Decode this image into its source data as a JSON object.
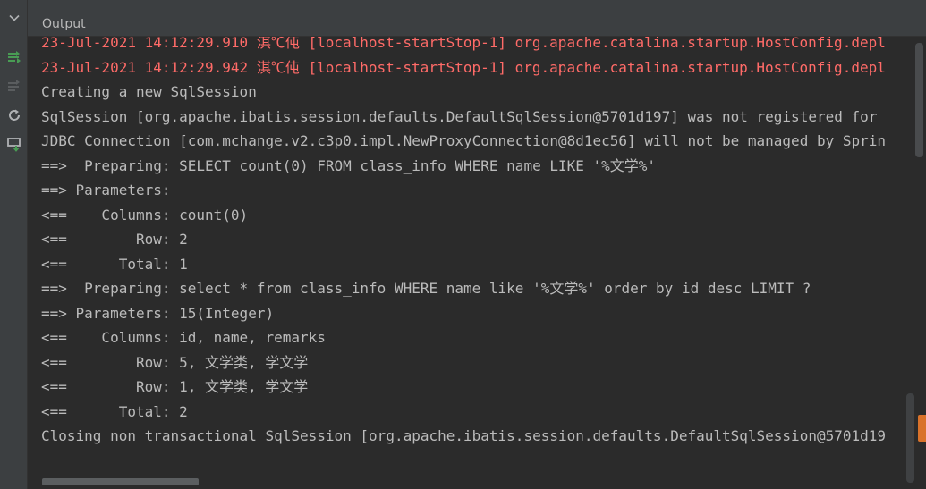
{
  "panel": {
    "title": "Output"
  },
  "toolbar": {
    "icons": [
      "collapse-chevron-icon",
      "scroll-to-end-icon",
      "scroll-disabled-icon",
      "rerun-icon",
      "deploy-icon"
    ]
  },
  "console": {
    "lines": [
      {
        "text": "23-Jul-2021 14:12:29.910 淇℃伅 [localhost-startStop-1] org.apache.catalina.startup.HostConfig.depl",
        "kind": "err"
      },
      {
        "text": "23-Jul-2021 14:12:29.942 淇℃伅 [localhost-startStop-1] org.apache.catalina.startup.HostConfig.depl",
        "kind": "err"
      },
      {
        "text": "Creating a new SqlSession",
        "kind": "out"
      },
      {
        "text": "SqlSession [org.apache.ibatis.session.defaults.DefaultSqlSession@5701d197] was not registered for",
        "kind": "out"
      },
      {
        "text": "JDBC Connection [com.mchange.v2.c3p0.impl.NewProxyConnection@8d1ec56] will not be managed by Sprin",
        "kind": "out"
      },
      {
        "text": "==>  Preparing: SELECT count(0) FROM class_info WHERE name LIKE '%文学%'",
        "kind": "out"
      },
      {
        "text": "==> Parameters: ",
        "kind": "out"
      },
      {
        "text": "<==    Columns: count(0)",
        "kind": "out"
      },
      {
        "text": "<==        Row: 2",
        "kind": "out"
      },
      {
        "text": "<==      Total: 1",
        "kind": "out"
      },
      {
        "text": "==>  Preparing: select * from class_info WHERE name like '%文学%' order by id desc LIMIT ?",
        "kind": "out"
      },
      {
        "text": "==> Parameters: 15(Integer)",
        "kind": "out"
      },
      {
        "text": "<==    Columns: id, name, remarks",
        "kind": "out"
      },
      {
        "text": "<==        Row: 5, 文学类, 学文学",
        "kind": "out"
      },
      {
        "text": "<==        Row: 1, 文学类, 学文学",
        "kind": "out"
      },
      {
        "text": "<==      Total: 2",
        "kind": "out"
      },
      {
        "text": "Closing non transactional SqlSession [org.apache.ibatis.session.defaults.DefaultSqlSession@5701d19",
        "kind": "out"
      }
    ]
  },
  "colors": {
    "background": "#2b2b2b",
    "panel": "#3c3f41",
    "text": "#bbbbbb",
    "error": "#ff6b68",
    "accent_green": "#499c54",
    "marker": "#d9722a"
  }
}
